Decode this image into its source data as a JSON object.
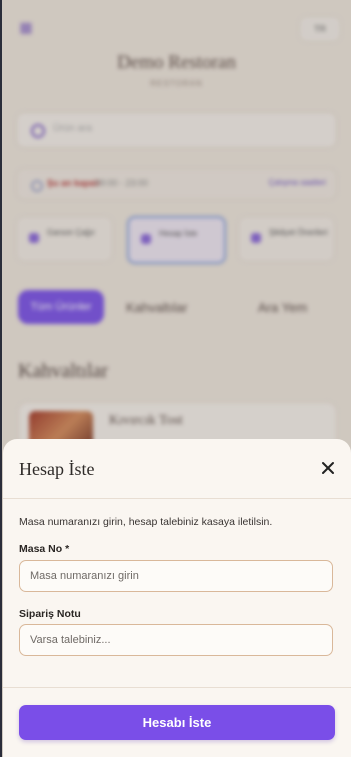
{
  "background": {
    "restaurant_name": "Demo Restoran",
    "tagline": "RESTORAN",
    "language": "TR",
    "search_placeholder": "Ürün ara",
    "info_status": "Şu an kapalı",
    "info_hours": "09:00 - 23:00",
    "info_link": "Çalışma saatleri",
    "actions": [
      "Garson Çağır",
      "Hesap İste",
      "Şikâyet Önerileri"
    ],
    "active_category": "Tüm Ürünler",
    "categories": [
      "Kahvaltılar",
      "Ara Yem"
    ],
    "section_title": "Kahvaltılar",
    "first_item": "Kıvırcık Tost"
  },
  "modal": {
    "title": "Hesap İste",
    "description": "Masa numaranızı girin, hesap talebiniz kasaya iletilsin.",
    "table_label": "Masa No *",
    "table_placeholder": "Masa numaranızı girin",
    "table_value": "",
    "note_label": "Sipariş Notu",
    "note_placeholder": "Varsa talebiniz...",
    "note_value": "",
    "submit_label": "Hesabı İste"
  },
  "colors": {
    "accent": "#7a4ee8",
    "field_border": "#d9b89a",
    "sheet_bg": "#faf6f1"
  }
}
